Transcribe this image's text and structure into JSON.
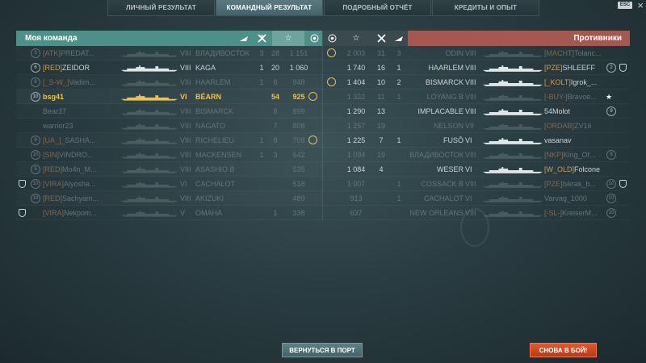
{
  "tabs": [
    {
      "label": "ЛИЧНЫЙ РЕЗУЛЬТАТ",
      "active": false
    },
    {
      "label": "КОМАНДНЫЙ РЕЗУЛЬТАТ",
      "active": true
    },
    {
      "label": "ПОДРОБНЫЙ ОТЧЁТ",
      "active": false
    },
    {
      "label": "КРЕДИТЫ И ОПЫТ",
      "active": false
    }
  ],
  "esc_label": "ESC",
  "my_team": {
    "title": "Моя команда",
    "players": [
      {
        "rank": "3",
        "clan": "[ATK]",
        "name": "PREDAT...",
        "tier": "VIII",
        "ship": "ВЛАДИВОСТОК",
        "frags": "3",
        "planes": "28",
        "xp": "1 151",
        "dead": true
      },
      {
        "rank": "6",
        "clan": "[RED]",
        "name": "ZEIDOR",
        "tier": "VIII",
        "ship": "KAGA",
        "frags": "1",
        "planes": "20",
        "xp": "1 060",
        "dead": false
      },
      {
        "rank": "8",
        "clan": "[_S-W_]",
        "name": "Vadim...",
        "tier": "VIII",
        "ship": "HAARLEM",
        "frags": "1",
        "planes": "8",
        "xp": "948",
        "dead": true
      },
      {
        "rank": "10",
        "clan": "",
        "name": "bsg41",
        "tier": "VI",
        "ship": "BÉARN",
        "frags": "",
        "planes": "54",
        "xp": "925",
        "dead": false,
        "me": true,
        "medal": true
      },
      {
        "rank": "",
        "clan": "",
        "name": "Bear37",
        "tier": "VIII",
        "ship": "BISMARCK",
        "frags": "",
        "planes": "8",
        "xp": "899",
        "dead": true
      },
      {
        "rank": "",
        "clan": "",
        "name": "warrior23",
        "tier": "VIII",
        "ship": "NAGATO",
        "frags": "",
        "planes": "7",
        "xp": "808",
        "dead": true
      },
      {
        "rank": "9",
        "clan": "[UA_]",
        "name": "_SASHA...",
        "tier": "VIII",
        "ship": "RICHELIEU",
        "frags": "1",
        "planes": "8",
        "xp": "708",
        "dead": true,
        "medal": true
      },
      {
        "rank": "10",
        "clan": "[SIN]",
        "name": "VINDRO...",
        "tier": "VIII",
        "ship": "MACKENSEN",
        "frags": "1",
        "planes": "3",
        "xp": "642",
        "dead": true
      },
      {
        "rank": "5",
        "clan": "[RED]",
        "name": "Mo4n_M...",
        "tier": "VIII",
        "ship": "ASASHIO B",
        "frags": "",
        "planes": "",
        "xp": "535",
        "dead": true
      },
      {
        "rank": "10",
        "clan": "[VIRA]",
        "name": "Alyosha...",
        "tier": "VI",
        "ship": "CACHALOT",
        "frags": "",
        "planes": "",
        "xp": "518",
        "dead": true,
        "shield": true
      },
      {
        "rank": "10",
        "clan": "[RED]",
        "name": "Sachyam...",
        "tier": "VIII",
        "ship": "AKIZUKI",
        "frags": "",
        "planes": "",
        "xp": "489",
        "dead": true
      },
      {
        "rank": "",
        "clan": "[VIRA]",
        "name": "Nekpom...",
        "tier": "V",
        "ship": "OMAHA",
        "frags": "",
        "planes": "1",
        "xp": "338",
        "dead": true,
        "shield": true
      }
    ]
  },
  "enemy_team": {
    "title": "Противники",
    "players": [
      {
        "medal": true,
        "xp": "2 003",
        "planes": "31",
        "frags": "3",
        "ship": "ODIN",
        "tier": "VIII",
        "clan": "[MACHT]",
        "name": "Tolanc...",
        "rank": "",
        "dead": true
      },
      {
        "medal": false,
        "xp": "1 740",
        "planes": "16",
        "frags": "1",
        "ship": "HAARLEM",
        "tier": "VIII",
        "clan": "[PZE]",
        "name": "SHLEEFF",
        "rank": "2",
        "dead": false,
        "shield": true
      },
      {
        "medal": true,
        "xp": "1 404",
        "planes": "10",
        "frags": "2",
        "ship": "BISMARCK",
        "tier": "VIII",
        "clan": "[_KOLT]",
        "name": "Igrok_...",
        "rank": "",
        "dead": false
      },
      {
        "medal": false,
        "xp": "1 322",
        "planes": "11",
        "frags": "1",
        "ship": "LOYANG B",
        "tier": "VIII",
        "clan": "[-BUY-]",
        "name": "Bravoe...",
        "rank": "",
        "dead": true,
        "star": true
      },
      {
        "medal": false,
        "xp": "1 290",
        "planes": "13",
        "frags": "",
        "ship": "IMPLACABLE",
        "tier": "VIII",
        "clan": "",
        "name": "54Molot",
        "rank": "9",
        "dead": false
      },
      {
        "medal": false,
        "xp": "1 257",
        "planes": "19",
        "frags": "",
        "ship": "NELSON",
        "tier": "VII",
        "clan": "[ORDAB]",
        "name": "ZV16",
        "rank": "",
        "dead": true
      },
      {
        "medal": false,
        "xp": "1 225",
        "planes": "7",
        "frags": "1",
        "ship": "FUSŌ",
        "tier": "VI",
        "clan": "",
        "name": "vasanav",
        "rank": "",
        "dead": false
      },
      {
        "medal": false,
        "xp": "1 094",
        "planes": "19",
        "frags": "",
        "ship": "ВЛАДИВОСТОК",
        "tier": "VIII",
        "clan": "[NKP]",
        "name": "King_Of...",
        "rank": "8",
        "dead": true
      },
      {
        "medal": false,
        "xp": "1 084",
        "planes": "4",
        "frags": "",
        "ship": "WESER",
        "tier": "VI",
        "clan": "[W_OLD]",
        "name": "Folcone",
        "rank": "",
        "dead": false
      },
      {
        "medal": false,
        "xp": "1 007",
        "planes": "",
        "frags": "1",
        "ship": "COSSACK B",
        "tier": "VIII",
        "clan": "[PZE]",
        "name": "Iskrak_b...",
        "rank": "10",
        "dead": true,
        "shield": true
      },
      {
        "medal": false,
        "xp": "913",
        "planes": "",
        "frags": "1",
        "ship": "CACHALOT",
        "tier": "VI",
        "clan": "",
        "name": "Varvag_1000",
        "rank": "10",
        "dead": true
      },
      {
        "medal": false,
        "xp": "637",
        "planes": "",
        "frags": "",
        "ship": "NEW ORLEANS",
        "tier": "VIII",
        "clan": "[-SL-]",
        "name": "KreiserM...",
        "rank": "10",
        "dead": true
      }
    ]
  },
  "buttons": {
    "port": "ВЕРНУТЬСЯ В ПОРТ",
    "battle": "СНОВА В БОЙ!"
  },
  "colors": {
    "ally_header": "#4f8f89",
    "enemy_header": "#a4584f",
    "player_highlight": "#f0c24a",
    "battle_button": "#d4502a"
  }
}
